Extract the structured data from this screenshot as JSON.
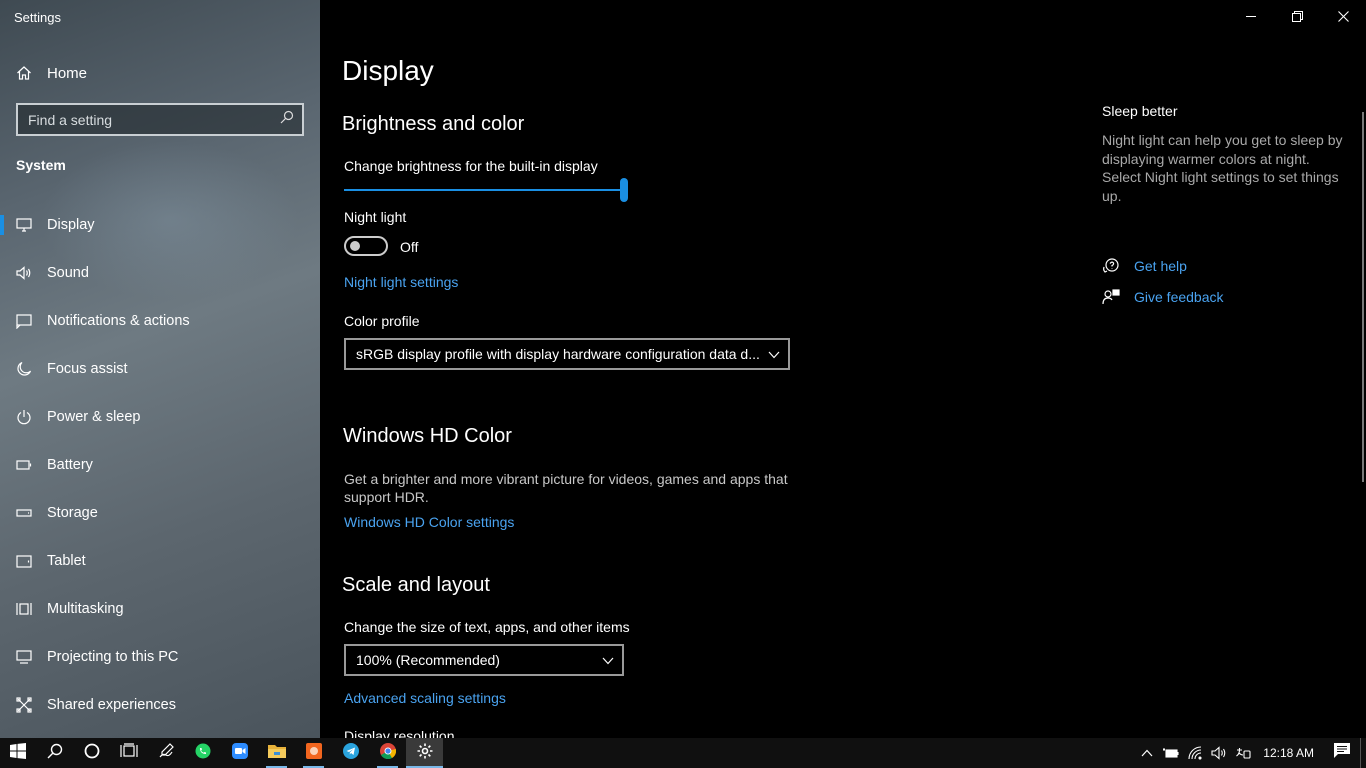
{
  "window": {
    "title": "Settings"
  },
  "sidebar": {
    "home_label": "Home",
    "search_placeholder": "Find a setting",
    "section": "System",
    "items": [
      {
        "label": "Display",
        "icon": "monitor-icon",
        "active": true
      },
      {
        "label": "Sound",
        "icon": "speaker-icon"
      },
      {
        "label": "Notifications & actions",
        "icon": "notification-icon"
      },
      {
        "label": "Focus assist",
        "icon": "moon-icon"
      },
      {
        "label": "Power & sleep",
        "icon": "power-icon"
      },
      {
        "label": "Battery",
        "icon": "battery-icon"
      },
      {
        "label": "Storage",
        "icon": "storage-icon"
      },
      {
        "label": "Tablet",
        "icon": "tablet-icon"
      },
      {
        "label": "Multitasking",
        "icon": "multitasking-icon"
      },
      {
        "label": "Projecting to this PC",
        "icon": "projecting-icon"
      },
      {
        "label": "Shared experiences",
        "icon": "shared-icon"
      }
    ]
  },
  "main": {
    "title": "Display",
    "brightness": {
      "heading": "Brightness and color",
      "slider_label": "Change brightness for the built-in display",
      "value": 1.0
    },
    "night_light": {
      "label": "Night light",
      "state": "Off",
      "settings_link": "Night light settings"
    },
    "color_profile": {
      "label": "Color profile",
      "value": "sRGB display profile with display hardware configuration data d..."
    },
    "hd_color": {
      "heading": "Windows HD Color",
      "description": "Get a brighter and more vibrant picture for videos, games and apps that support HDR.",
      "link": "Windows HD Color settings"
    },
    "scale": {
      "heading": "Scale and layout",
      "label": "Change the size of text, apps, and other items",
      "value": "100% (Recommended)",
      "link": "Advanced scaling settings",
      "cut_off_label": "Display resolution"
    }
  },
  "side_panel": {
    "title": "Sleep better",
    "description": "Night light can help you get to sleep by displaying warmer colors at night. Select Night light settings to set things up.",
    "get_help": "Get help",
    "give_feedback": "Give feedback"
  },
  "taskbar": {
    "apps": [
      "start-icon",
      "search-icon",
      "cortana-icon",
      "task-view-icon",
      "pen-workspace-icon",
      "whatsapp-icon",
      "zoom-icon",
      "file-explorer-icon",
      "orange-app-icon",
      "telegram-icon",
      "chrome-icon",
      "settings-icon"
    ],
    "time": "12:18 AM"
  },
  "colors": {
    "accent": "#1a8fe3",
    "link": "#4aa3f0"
  }
}
